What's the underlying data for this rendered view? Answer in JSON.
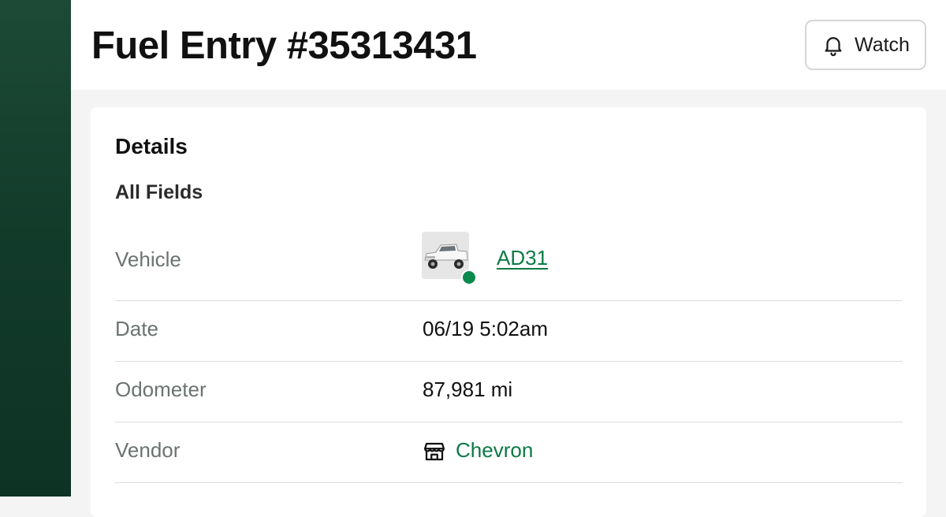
{
  "header": {
    "title": "Fuel Entry #35313431",
    "watch_label": "Watch"
  },
  "details": {
    "title": "Details",
    "section": "All Fields",
    "fields": {
      "vehicle": {
        "label": "Vehicle",
        "value": "AD31",
        "status_color": "#0b8a4d"
      },
      "date": {
        "label": "Date",
        "value": "06/19 5:02am"
      },
      "odometer": {
        "label": "Odometer",
        "value": "87,981 mi"
      },
      "vendor": {
        "label": "Vendor",
        "value": "Chevron"
      }
    }
  },
  "colors": {
    "sidebar": "#143f2e",
    "link": "#0b7a45",
    "status_active": "#0b8a4d"
  },
  "icons": {
    "watch": "bell-icon",
    "vendor": "storefront-icon"
  }
}
